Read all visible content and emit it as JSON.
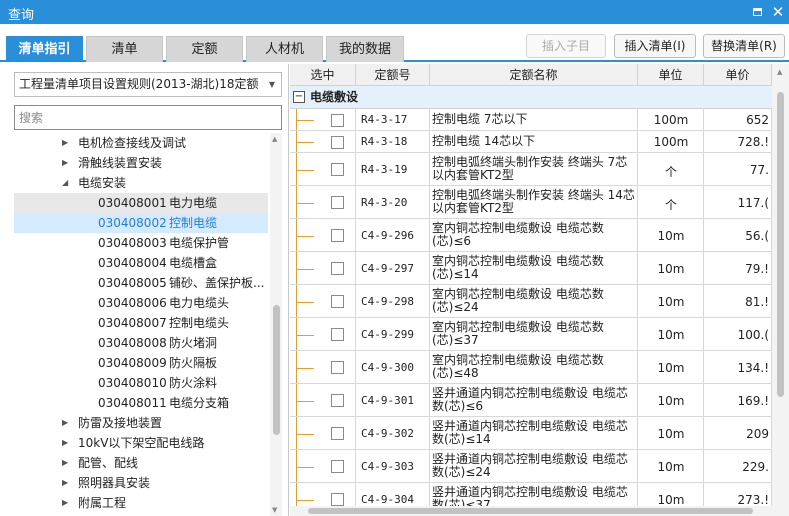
{
  "window": {
    "title": "查询",
    "maximize_icon": "maximize-icon",
    "close_icon": "close-icon",
    "close_glyph": "✕"
  },
  "tabs": [
    {
      "label": "清单指引",
      "active": true
    },
    {
      "label": "清单",
      "active": false
    },
    {
      "label": "定额",
      "active": false
    },
    {
      "label": "人材机",
      "active": false
    },
    {
      "label": "我的数据",
      "active": false
    }
  ],
  "actions": {
    "insert_child": "插入子目",
    "insert_list": "插入清单(I)",
    "replace_list": "替换清单(R)"
  },
  "left": {
    "rule_select": "工程量清单项目设置规则(2013-湖北)18定额",
    "search_placeholder": "搜索",
    "tree": [
      {
        "code": "",
        "text": "电机检查接线及调试",
        "arrow": "▶"
      },
      {
        "code": "",
        "text": "滑触线装置安装",
        "arrow": "▶"
      },
      {
        "code": "",
        "text": "电缆安装",
        "arrow": "◢"
      },
      {
        "code": "030408001",
        "text": "电力电缆",
        "arrow": ""
      },
      {
        "code": "030408002",
        "text": "控制电缆",
        "arrow": ""
      },
      {
        "code": "030408003",
        "text": "电缆保护管",
        "arrow": ""
      },
      {
        "code": "030408004",
        "text": "电缆槽盒",
        "arrow": ""
      },
      {
        "code": "030408005",
        "text": "铺砂、盖保护板...",
        "arrow": ""
      },
      {
        "code": "030408006",
        "text": "电力电缆头",
        "arrow": ""
      },
      {
        "code": "030408007",
        "text": "控制电缆头",
        "arrow": ""
      },
      {
        "code": "030408008",
        "text": "防火堵洞",
        "arrow": ""
      },
      {
        "code": "030408009",
        "text": "防火隔板",
        "arrow": ""
      },
      {
        "code": "030408010",
        "text": "防火涂料",
        "arrow": ""
      },
      {
        "code": "030408011",
        "text": "电缆分支箱",
        "arrow": ""
      },
      {
        "code": "",
        "text": "防雷及接地装置",
        "arrow": "▶"
      },
      {
        "code": "",
        "text": "10kV以下架空配电线路",
        "arrow": "▶"
      },
      {
        "code": "",
        "text": "配管、配线",
        "arrow": "▶"
      },
      {
        "code": "",
        "text": "照明器具安装",
        "arrow": "▶"
      },
      {
        "code": "",
        "text": "附属工程",
        "arrow": "▶"
      }
    ],
    "selected_index": 4,
    "hover_index": 3
  },
  "grid": {
    "headers": {
      "select": "选中",
      "code": "定额号",
      "name": "定额名称",
      "unit": "单位",
      "price": "单价"
    },
    "group": {
      "toggle": "−",
      "label": "电缆敷设"
    },
    "rows": [
      {
        "code": "R4-3-17",
        "name": "控制电缆 7芯以下",
        "unit": "100m",
        "price": "652"
      },
      {
        "code": "R4-3-18",
        "name": "控制电缆 14芯以下",
        "unit": "100m",
        "price": "728.!"
      },
      {
        "code": "R4-3-19",
        "name": "控制电弧终端头制作安装 终端头 7芯以内套管KT2型",
        "unit": "个",
        "price": "77."
      },
      {
        "code": "R4-3-20",
        "name": "控制电弧终端头制作安装 终端头 14芯以内套管KT2型",
        "unit": "个",
        "price": "117.("
      },
      {
        "code": "C4-9-296",
        "name": "室内铜芯控制电缆敷设 电缆芯数(芯)≤6",
        "unit": "10m",
        "price": "56.("
      },
      {
        "code": "C4-9-297",
        "name": "室内铜芯控制电缆敷设 电缆芯数(芯)≤14",
        "unit": "10m",
        "price": "79.!"
      },
      {
        "code": "C4-9-298",
        "name": "室内铜芯控制电缆敷设 电缆芯数(芯)≤24",
        "unit": "10m",
        "price": "81.!"
      },
      {
        "code": "C4-9-299",
        "name": "室内铜芯控制电缆敷设 电缆芯数(芯)≤37",
        "unit": "10m",
        "price": "100.("
      },
      {
        "code": "C4-9-300",
        "name": "室内铜芯控制电缆敷设 电缆芯数(芯)≤48",
        "unit": "10m",
        "price": "134.!"
      },
      {
        "code": "C4-9-301",
        "name": "竖井通道内铜芯控制电缆敷设 电缆芯数(芯)≤6",
        "unit": "10m",
        "price": "169.!"
      },
      {
        "code": "C4-9-302",
        "name": "竖井通道内铜芯控制电缆敷设 电缆芯数(芯)≤14",
        "unit": "10m",
        "price": "209"
      },
      {
        "code": "C4-9-303",
        "name": "竖井通道内铜芯控制电缆敷设 电缆芯数(芯)≤24",
        "unit": "10m",
        "price": "229."
      },
      {
        "code": "C4-9-304",
        "name": "竖井通道内铜芯控制电缆敷设 电缆芯数(芯)≤37",
        "unit": "10m",
        "price": "273.!"
      }
    ]
  },
  "colors": {
    "accent": "#2a8fd9",
    "selected_bg": "#d6eaff",
    "selected_text": "#1e7fd6",
    "tree_line": "#e0a030"
  }
}
